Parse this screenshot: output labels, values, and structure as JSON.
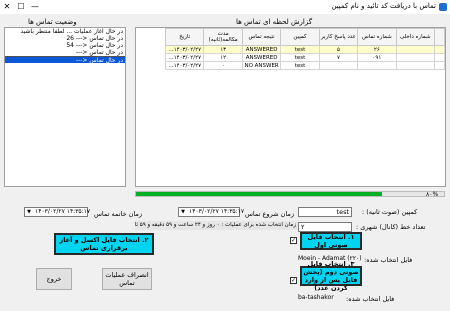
{
  "window": {
    "title": "تماس با دریافت کد تائید و نام کمپین",
    "controls": {
      "minimize": "—",
      "maximize": "☐",
      "close": "✕"
    }
  },
  "status_panel": {
    "title": "وضعیت تماس ها",
    "items": [
      {
        "text": "در حال آغاز عملیات ... لطفا منتظر باشید",
        "selected": false,
        "dashed": false
      },
      {
        "text": "در حال تماس",
        "prefix": "<--- 26",
        "selected": false,
        "dashed": false
      },
      {
        "text": "در حال تماس",
        "prefix": "<--- 54",
        "selected": false,
        "dashed": false
      },
      {
        "text": "در حال تماس",
        "prefix": "<--- ",
        "selected": false,
        "dashed": false
      },
      {
        "text": "در حال تماس",
        "prefix": "<--- ",
        "selected": true,
        "dashed": true
      }
    ]
  },
  "report_panel": {
    "title": "گزارش لحظه ای تماس ها",
    "columns": [
      "شماره داخلی",
      "شماره تماس",
      "عدد پاسخ کاربر",
      "کمپین",
      "نتیجه تماس",
      "مدت مکالمه(ثانیه)",
      "تاریخ"
    ],
    "rows": [
      {
        "internal": "",
        "phone": "۲۶",
        "answer": "۵",
        "campaign": "test",
        "result": "ANSWERED",
        "duration": "۱۳",
        "date": "۱۴۰۳/۰۲/۲۷...",
        "highlight": true
      },
      {
        "internal": "",
        "phone": "۰۹۱",
        "answer": "۷",
        "campaign": "test",
        "result": "ANSWERED",
        "duration": "۱۲",
        "date": "۱۴۰۳/۰۲/۲۷...",
        "highlight": false
      },
      {
        "internal": "",
        "phone": "",
        "answer": "",
        "campaign": "test",
        "result": "NO ANSWER",
        "duration": "۰",
        "date": "۱۴۰۳/۰۲/۲۷...",
        "highlight": false
      }
    ]
  },
  "progress": {
    "label": "۸۰%",
    "value_percent": 80,
    "color": "#06b025"
  },
  "form": {
    "campaign_label": "کمپین (صوت ثانیه) :",
    "campaign_value": "test",
    "lines_label": "تعداد خط (کانال) شهری :",
    "lines_value": "۲",
    "start_time_label": "زمان شروع تماس",
    "start_time_value": "۱۴۰۳/۰۲/۲۷ ۱۴:۳۵:۱۷",
    "end_time_label": "زمان خاتمه تماس",
    "end_time_value": "۱۴۰۳/۰۲/۲۷ ۱۴:۳۵:۱۷",
    "info_text": "زمان انتخاب شده برای عملیات : ۰ روز و ۲۴ ساعت و ۵۹ دقیقه و ۵۹ ثانیه"
  },
  "buttons": {
    "select_excel": "۲. انتخاب فایل اکسل و آغاز برقراری تماس",
    "select_voice_1": "۱. انتخاب فایل صوتی اول",
    "select_voice_2": "۳. انتخاب فایل صوتی دوم (پخش فایل پس از وارد کردن عدد)",
    "cancel_ops": "انصراف عملیات تماس",
    "exit": "خروج"
  },
  "files": {
    "selected_1_label": "فایل انتخاب شده:",
    "selected_1_value": "Moein - Adamat (۲۲۰)",
    "selected_2_label": "فایل انتخاب شده:",
    "selected_2_value": "ba-tashakor"
  },
  "colors": {
    "accent": "#0a58d6",
    "cyan_button": "#00d4f0",
    "highlight_row": "#ffffcc",
    "progress": "#06b025",
    "redacted": "#f6c5e3"
  }
}
